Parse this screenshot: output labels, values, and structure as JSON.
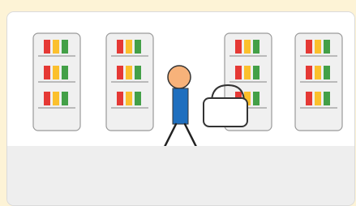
{
  "colors": {
    "background": "#fdf3d6",
    "card_bg": "#f4f4f4",
    "scene_bg": "#ffffff",
    "footer_bg": "#eeeeee",
    "shelf_fill": "#f0f0f0",
    "shelf_stroke": "#9a9a9a",
    "item_red": "#e53935",
    "item_yellow": "#fbc02d",
    "item_green": "#43a047",
    "person_skin": "#f7b27a",
    "person_shirt": "#1f6fbf",
    "bag_fill": "#ffffff"
  },
  "icons": {
    "shelves": "shelf-unit-icon",
    "person": "shopper-figure-icon",
    "bag": "shopping-basket-icon"
  }
}
